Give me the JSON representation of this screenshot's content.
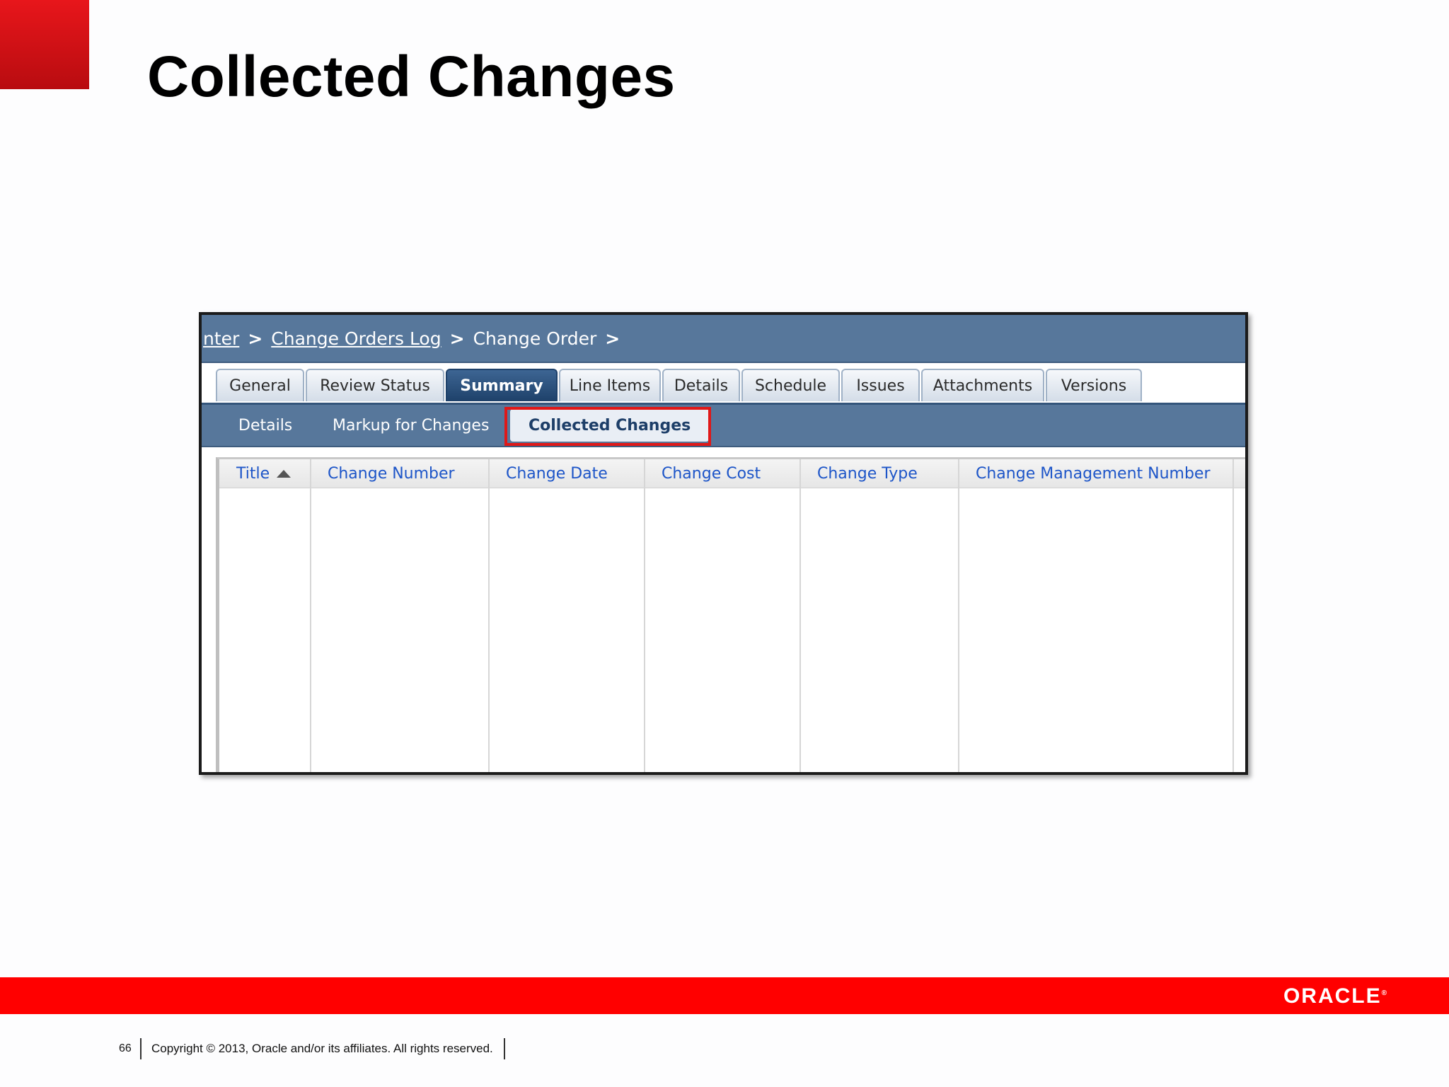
{
  "slide": {
    "title": "Collected Changes",
    "page_number": "66",
    "copyright": "Copyright © 2013, Oracle and/or its affiliates. All rights reserved.",
    "logo": "ORACLE",
    "accent_red": "#ff0000"
  },
  "breadcrumb": {
    "items": [
      {
        "label": "nter",
        "link": true
      },
      {
        "label": "Change Orders Log",
        "link": true
      },
      {
        "label": "Change Order",
        "link": false
      }
    ],
    "separator": ">"
  },
  "tabs": [
    {
      "label": "General",
      "active": false
    },
    {
      "label": "Review Status",
      "active": false
    },
    {
      "label": "Summary",
      "active": true
    },
    {
      "label": "Line Items",
      "active": false
    },
    {
      "label": "Details",
      "active": false
    },
    {
      "label": "Schedule",
      "active": false
    },
    {
      "label": "Issues",
      "active": false
    },
    {
      "label": "Attachments",
      "active": false
    },
    {
      "label": "Versions",
      "active": false
    }
  ],
  "subtabs": [
    {
      "label": "Details",
      "active": false
    },
    {
      "label": "Markup for Changes",
      "active": false
    },
    {
      "label": "Collected Changes",
      "active": true
    }
  ],
  "table": {
    "columns": [
      {
        "label": "Title",
        "sorted": "asc"
      },
      {
        "label": "Change Number"
      },
      {
        "label": "Change Date"
      },
      {
        "label": "Change Cost"
      },
      {
        "label": "Change Type"
      },
      {
        "label": "Change Management Number"
      }
    ],
    "rows": []
  }
}
